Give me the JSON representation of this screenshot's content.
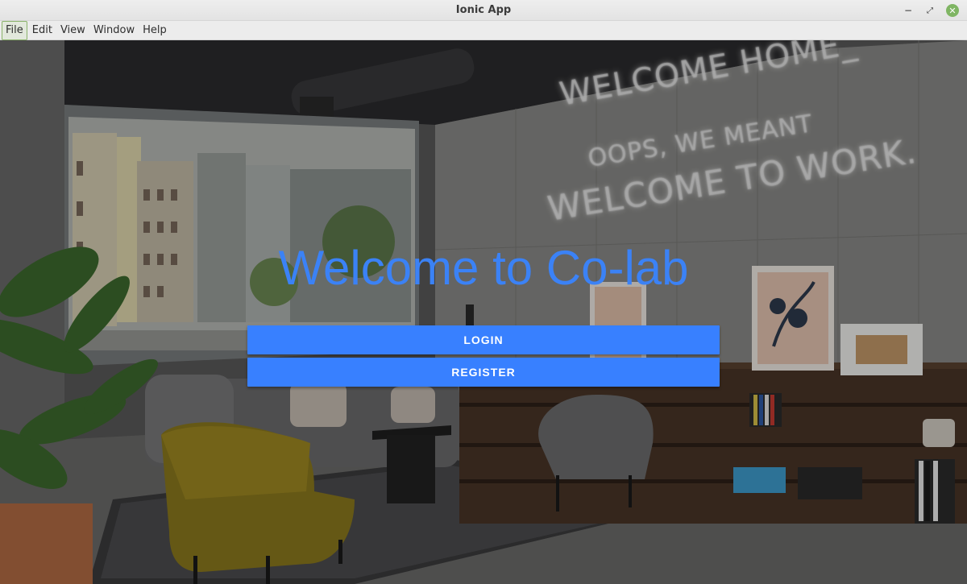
{
  "window": {
    "title": "Ionic App",
    "controls": {
      "minimize_icon": "minimize-icon",
      "maximize_icon": "maximize-icon",
      "close_icon": "close-icon",
      "close_color": "#7fb563"
    }
  },
  "menubar": {
    "items": [
      {
        "label": "File",
        "active": true
      },
      {
        "label": "Edit"
      },
      {
        "label": "View"
      },
      {
        "label": "Window"
      },
      {
        "label": "Help"
      }
    ]
  },
  "page": {
    "heading": "Welcome to Co-lab",
    "heading_color": "#3b82f6",
    "login_label": "LOGIN",
    "register_label": "REGISTER",
    "button_color": "#3880ff"
  },
  "background": {
    "neon_lines": [
      "WELCOME HOME_",
      "OOPS, WE MEANT",
      "WELCOME TO WORK."
    ]
  }
}
